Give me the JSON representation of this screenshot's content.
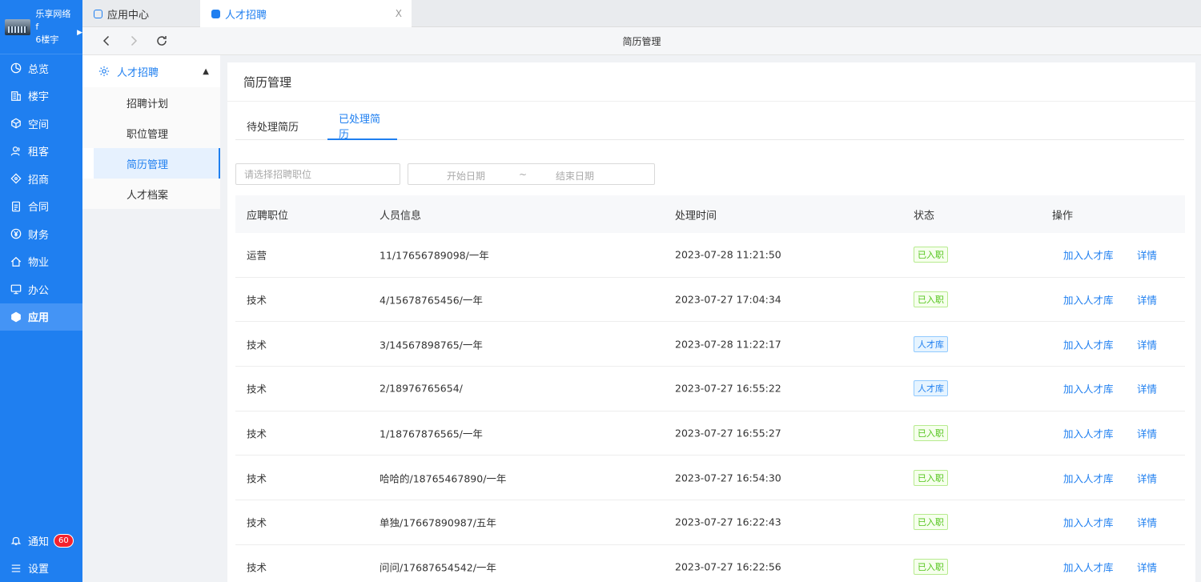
{
  "brand": {
    "name": "乐享网络f",
    "building": "6楼宇"
  },
  "nav": {
    "items": [
      {
        "label": "总览",
        "icon": "dashboard-icon"
      },
      {
        "label": "楼宇",
        "icon": "building-icon"
      },
      {
        "label": "空间",
        "icon": "cube-icon"
      },
      {
        "label": "租客",
        "icon": "users-icon"
      },
      {
        "label": "招商",
        "icon": "tag-icon"
      },
      {
        "label": "合同",
        "icon": "document-icon"
      },
      {
        "label": "财务",
        "icon": "yen-icon"
      },
      {
        "label": "物业",
        "icon": "home-icon"
      },
      {
        "label": "办公",
        "icon": "monitor-icon"
      },
      {
        "label": "应用",
        "icon": "box-icon"
      }
    ],
    "notify_label": "通知",
    "notify_count": "60",
    "settings_label": "设置"
  },
  "tabs_top": [
    {
      "label": "应用中心"
    },
    {
      "label": "人才招聘",
      "close": "X"
    }
  ],
  "toolbar": {
    "title": "简历管理"
  },
  "subnav": {
    "group": "人才招聘",
    "items": [
      "招聘计划",
      "职位管理",
      "简历管理",
      "人才档案"
    ]
  },
  "main": {
    "title": "简历管理",
    "tabs": [
      "待处理简历",
      "已处理简历"
    ],
    "filter_placeholder": "请选择招聘职位",
    "date_start": "开始日期",
    "date_sep": "~",
    "date_end": "结束日期",
    "columns": [
      "应聘职位",
      "人员信息",
      "处理时间",
      "状态",
      "操作"
    ],
    "action_add": "加入人才库",
    "action_detail": "详情",
    "rows": [
      {
        "position": "运营",
        "info": "11/17656789098/一年",
        "time": "2023-07-28 11:21:50",
        "status": "已入职"
      },
      {
        "position": "技术",
        "info": "4/15678765456/一年",
        "time": "2023-07-27 17:04:34",
        "status": "已入职"
      },
      {
        "position": "技术",
        "info": "3/14567898765/一年",
        "time": "2023-07-28 11:22:17",
        "status": "人才库"
      },
      {
        "position": "技术",
        "info": "2/18976765654/",
        "time": "2023-07-27 16:55:22",
        "status": "人才库"
      },
      {
        "position": "技术",
        "info": "1/18767876565/一年",
        "time": "2023-07-27 16:55:27",
        "status": "已入职"
      },
      {
        "position": "技术",
        "info": "哈哈的/18765467890/一年",
        "time": "2023-07-27 16:54:30",
        "status": "已入职"
      },
      {
        "position": "技术",
        "info": "单独/17667890987/五年",
        "time": "2023-07-27 16:22:43",
        "status": "已入职"
      },
      {
        "position": "技术",
        "info": "问问/17687654542/一年",
        "time": "2023-07-27 16:22:56",
        "status": "已入职"
      }
    ]
  },
  "colors": {
    "primary": "#1f7ff0",
    "success": "#52c41a",
    "danger": "#f5222d"
  }
}
